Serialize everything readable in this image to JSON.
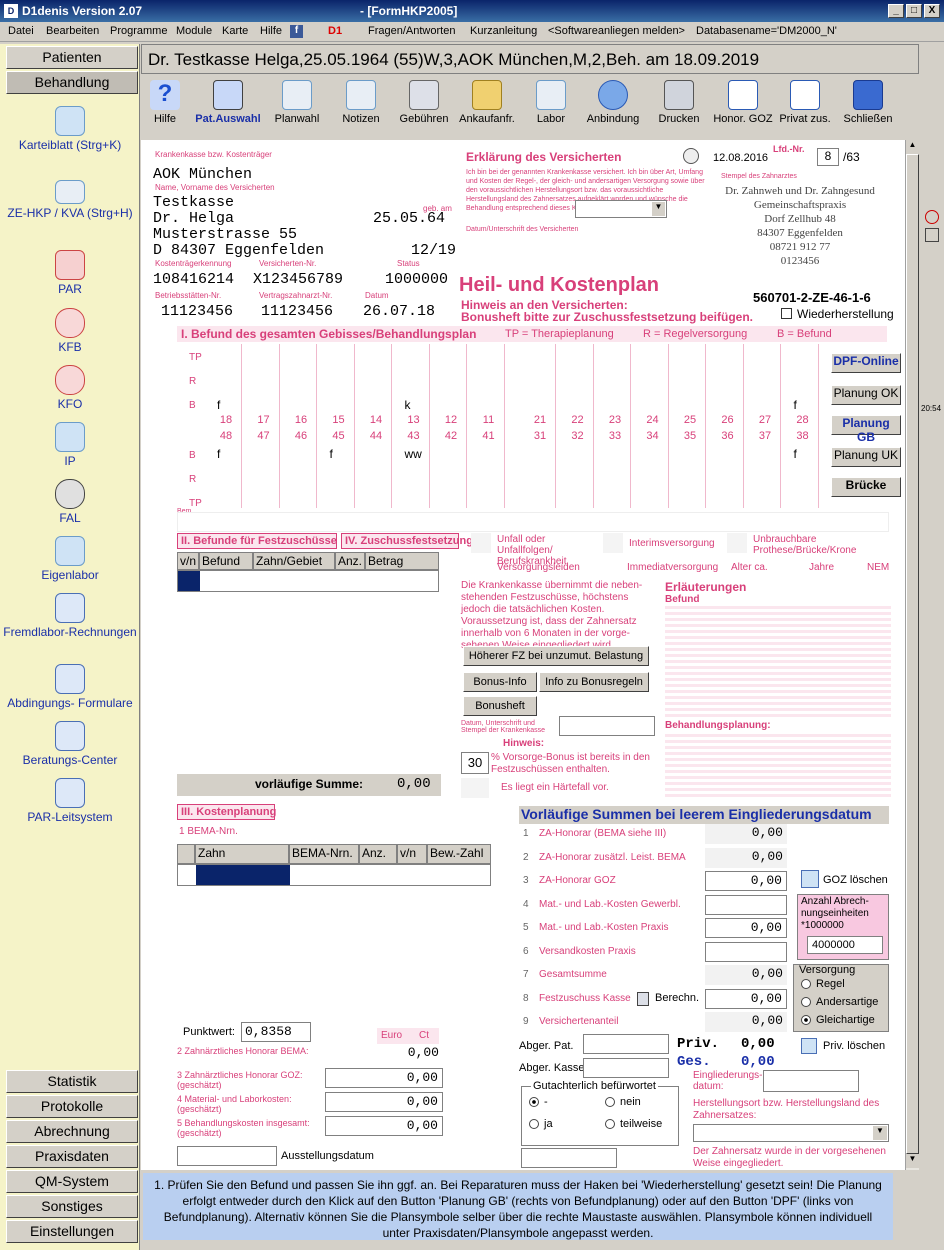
{
  "window": {
    "title": "D1denis Version 2.07",
    "form_title": "- [FormHKP2005]",
    "min": "_",
    "max": "□",
    "close": "X"
  },
  "menu": [
    "Datei",
    "Bearbeiten",
    "Programme",
    "Module",
    "Karte",
    "Hilfe",
    "Fragen/Antworten",
    "Kurzanleitung",
    "<Softwareanliegen melden>",
    "Databasename='DM2000_N'"
  ],
  "sidebar": {
    "top_buttons": [
      "Patienten",
      "Behandlung"
    ],
    "items": [
      "Karteiblatt (Strg+K)",
      "ZE-HKP / KVA (Strg+H)",
      "PAR",
      "KFB",
      "KFO",
      "IP",
      "FAL",
      "Eigenlabor",
      "Fremdlabor-Rechnungen",
      "Abdingungs- Formulare",
      "Beratungs-Center",
      "PAR-Leitsystem"
    ],
    "bottom_buttons": [
      "Statistik",
      "Protokolle",
      "Abrechnung",
      "Praxisdaten",
      "QM-System",
      "Sonstiges",
      "Einstellungen"
    ]
  },
  "header": {
    "patient": "Dr. Testkasse Helga,25.05.1964 (55)W,3,AOK München,M,2,Beh. am 18.09.2019"
  },
  "toolbar": [
    "Hilfe",
    "Pat.Auswahl",
    "Planwahl",
    "Notizen",
    "Gebühren",
    "Ankaufanfr.",
    "Labor",
    "Anbindung",
    "Drucken",
    "Honor. GOZ",
    "Privat zus.",
    "Schließen"
  ],
  "form": {
    "kasse_label": "Krankenkasse bzw. Kostenträger",
    "kasse": "AOK München",
    "name_label": "Name, Vorname des Versicherten",
    "nachname": "Testkasse",
    "vorname": "Dr. Helga",
    "geb_label": "geb. am",
    "geb": "25.05.64",
    "strasse": "Musterstrasse 55",
    "ort": "D 84307 Eggenfelden",
    "gueltig": "12/19",
    "kennung_label": "Kostenträgerkennung",
    "versnr_label": "Versicherten-Nr.",
    "status_label": "Status",
    "kennung": "108416214",
    "versnr": "X123456789",
    "status": "1000000",
    "bsnr_label": "Betriebsstätten-Nr.",
    "lanr_label": "Vertragszahnarzt-Nr.",
    "datum_label": "Datum",
    "bsnr": "11123456",
    "lanr": "11123456",
    "datum": "26.07.18",
    "erklaerung_title": "Erklärung des Versicherten",
    "erklaerung_text": "Ich bin bei der genannten Krankenkasse versichert. Ich bin über Art, Umfang und Kosten der Regel-, der gleich- und andersartigen Versorgung sowie über den voraussichtlichen Herstellungsort bzw. das voraussichtliche Herstellungsland des Zahnersatzes aufgeklärt worden und wünsche die Behandlung entsprechend dieses Kostenplans.",
    "unterschrift_label": "Datum/Unterschrift des Versicherten",
    "plan_date": "12.08.2016",
    "lfd_label": "Lfd.-Nr.",
    "lfd": "8",
    "lfd_total": "/63",
    "stempel_label": "Stempel des Zahnarztes",
    "praxis": [
      "Dr. Zahnweh und Dr. Zahngesund",
      "Gemeinschaftspraxis",
      "Dorf Zellhub 48",
      "84307 Eggenfelden",
      "08721 912 77",
      "0123456"
    ],
    "hkp_title": "Heil- und Kostenplan",
    "hinweis1": "Hinweis an den Versicherten:",
    "hinweis2": "Bonusheft bitte zur Zuschussfestsetzung beifügen.",
    "plan_nr": "560701-2-ZE-46-1-6",
    "wiederherstellung": "Wiederherstellung",
    "section1": "I. Befund des gesamten Gebisses/Behandlungsplan",
    "tp_legend": "TP = Therapieplanung",
    "r_legend": "R = Regelversorgung",
    "b_legend": "B = Befund",
    "row_labels": [
      "TP",
      "R",
      "B",
      "B",
      "R",
      "TP"
    ],
    "upper_teeth": [
      "18",
      "17",
      "16",
      "15",
      "14",
      "13",
      "12",
      "11",
      "21",
      "22",
      "23",
      "24",
      "25",
      "26",
      "27",
      "28"
    ],
    "lower_teeth": [
      "48",
      "47",
      "46",
      "45",
      "44",
      "43",
      "42",
      "41",
      "31",
      "32",
      "33",
      "34",
      "35",
      "36",
      "37",
      "38"
    ],
    "upper_befund": {
      "18": "f",
      "13": "k",
      "28": "f"
    },
    "lower_befund": {
      "48": "f",
      "45": "f",
      "43": "ww",
      "38": "f"
    },
    "bem_label": "Bem",
    "section2": "II. Befunde für Festzuschüsse",
    "section4": "IV. Zuschussfestsetzung",
    "fz_headers": [
      "v/n",
      "Befund",
      "Zahn/Gebiet",
      "Anz.",
      "Betrag"
    ],
    "unfall": "Unfall oder Unfallfolgen/ Berufskrankheit",
    "interims": "Interimsversorgung",
    "unbrauchbar": "Unbrauchbare Prothese/Brücke/Krone",
    "versorgungsleiden": "Versorgungsleiden",
    "immediat": "Immediatversorgung",
    "alter": "Alter ca.",
    "jahre": "Jahre",
    "nem": "NEM",
    "kasse_text": "Die Krankenkasse übernimmt die neben-stehenden Festzuschüsse, höchstens jedoch die tatsächlichen Kosten. Voraussetzung ist, dass der Zahnersatz innerhalb von 6 Monaten in der vorge-sehenen Weise eingegliedert wird.",
    "btn_hoeherer": "Höherer FZ bei unzumut. Belastung",
    "btn_bonusinfo": "Bonus-Info",
    "btn_infobonus": "Info zu Bonusregeln",
    "btn_bonusheft": "Bonusheft",
    "datum_stempel": "Datum, Unterschrift und Stempel der Krankenkasse",
    "hinweise": "Hinweis:",
    "bonus_pct": "30",
    "bonus_text": "% Vorsorge-Bonus ist bereits in den Festzuschüssen enthalten.",
    "haertefall": "Es liegt ein Härtefall vor.",
    "erlaeuterungen": "Erläuterungen",
    "befund_label": "Befund",
    "behandlungsplanung": "Behandlungsplanung:",
    "vorl_summe_label": "vorläufige Summe:",
    "vorl_summe": "0,00",
    "section3": "III. Kostenplanung",
    "bema_label": "1 BEMA-Nrn.",
    "kp_headers": [
      "Zahn",
      "BEMA-Nrn.",
      "Anz.",
      "v/n",
      "Bew.-Zahl"
    ],
    "punktwert_label": "Punktwert:",
    "punktwert": "0,8358",
    "euro": "Euro",
    "ct": "Ct",
    "kp_rows": [
      {
        "label": "2 Zahnärztliches Honorar BEMA:",
        "value": "0,00"
      },
      {
        "label": "3 Zahnärztliches Honorar GOZ: (geschätzt)",
        "value": "0,00"
      },
      {
        "label": "4 Material- und Laborkosten: (geschätzt)",
        "value": "0,00"
      },
      {
        "label": "5 Behandlungskosten insgesamt: (geschätzt)",
        "value": "0,00"
      }
    ],
    "ausstellungsdatum": "Ausstellungsdatum",
    "vs_title": "Vorläufige Summen bei leerem Eingliederungsdatum",
    "vs_rows": [
      {
        "n": "1",
        "label": "ZA-Honorar (BEMA siehe III)",
        "value": "0,00"
      },
      {
        "n": "2",
        "label": "ZA-Honorar zusätzl. Leist. BEMA",
        "value": "0,00"
      },
      {
        "n": "3",
        "label": "ZA-Honorar GOZ",
        "value": "0,00"
      },
      {
        "n": "4",
        "label": "Mat.- und Lab.-Kosten Gewerbl.",
        "value": ""
      },
      {
        "n": "5",
        "label": "Mat.- und Lab.-Kosten Praxis",
        "value": "0,00"
      },
      {
        "n": "6",
        "label": "Versandkosten Praxis",
        "value": ""
      },
      {
        "n": "7",
        "label": "Gesamtsumme",
        "value": "0,00"
      },
      {
        "n": "8",
        "label": "Festzuschuss Kasse",
        "value": "0,00"
      },
      {
        "n": "9",
        "label": "Versichertenanteil",
        "value": "0,00"
      }
    ],
    "goz_loeschen": "GOZ löschen",
    "anzahl_label": "Anzahl Abrech-nungseinheiten *1000000",
    "anzahl": "4000000",
    "berechn": "Berechn.",
    "versorgung_title": "Versorgung",
    "versorgung_opts": [
      "Regel",
      "Andersartige",
      "Gleichartige"
    ],
    "abger_pat": "Abger. Pat.",
    "abger_kasse": "Abger. Kasse",
    "priv_label": "Priv.",
    "priv_value": "0,00",
    "ges_label": "Ges.",
    "ges_value": "0,00",
    "priv_loeschen": "Priv. löschen",
    "gutachten_title": "Gutachterlich befürwortet",
    "gutachten_opts": [
      "-",
      "nein",
      "ja",
      "teilweise"
    ],
    "eingliederung_label": "Eingliederungs-datum:",
    "herstellungsort_label": "Herstellungsort bzw. Herstellungsland des Zahnersatzes:",
    "herstellung_note": "Der Zahnersatz wurde in der vorgesehenen Weise eingegliedert."
  },
  "right_buttons": [
    "DPF-Online",
    "Planung OK",
    "Planung GB",
    "Planung UK",
    "Brücke"
  ],
  "clock": "20:54",
  "info_text": "1. Prüfen Sie den Befund und passen Sie ihn ggf. an. Bei Reparaturen muss der Haken bei 'Wiederherstellung' gesetzt sein! Die Planung erfolgt entweder durch den Klick auf den Button 'Planung GB' (rechts von Befundplanung) oder auf den Button 'DPF' (links von Befundplanung). Alternativ können Sie die Plansymbole selber über die rechte Maustaste auswählen. Plansymbole können individuell unter Praxisdaten/Plansymbole angepasst werden.",
  "colors": {
    "titlebar": "#0a246a",
    "sidebar_bg": "#f5f3c8",
    "pink": "#d8407a",
    "blue_title": "#1a2fa8",
    "info_bg": "#b9cff0"
  }
}
